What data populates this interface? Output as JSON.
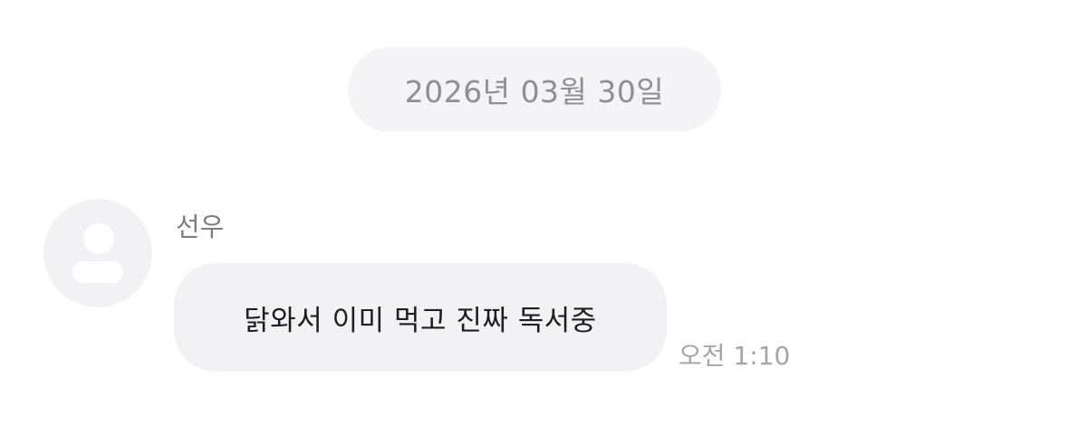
{
  "date_divider": {
    "label": "2026년 03월 30일"
  },
  "message": {
    "sender": "선우",
    "avatar_icon": "default-person-icon",
    "text": "닭와서 이미 먹고 진짜 독서중",
    "time": "오전 1:10"
  },
  "colors": {
    "background": "#ffffff",
    "pill_background": "#f4f4f7",
    "bubble_background": "#f2f2f5",
    "secondary_text": "#8e8e96"
  }
}
